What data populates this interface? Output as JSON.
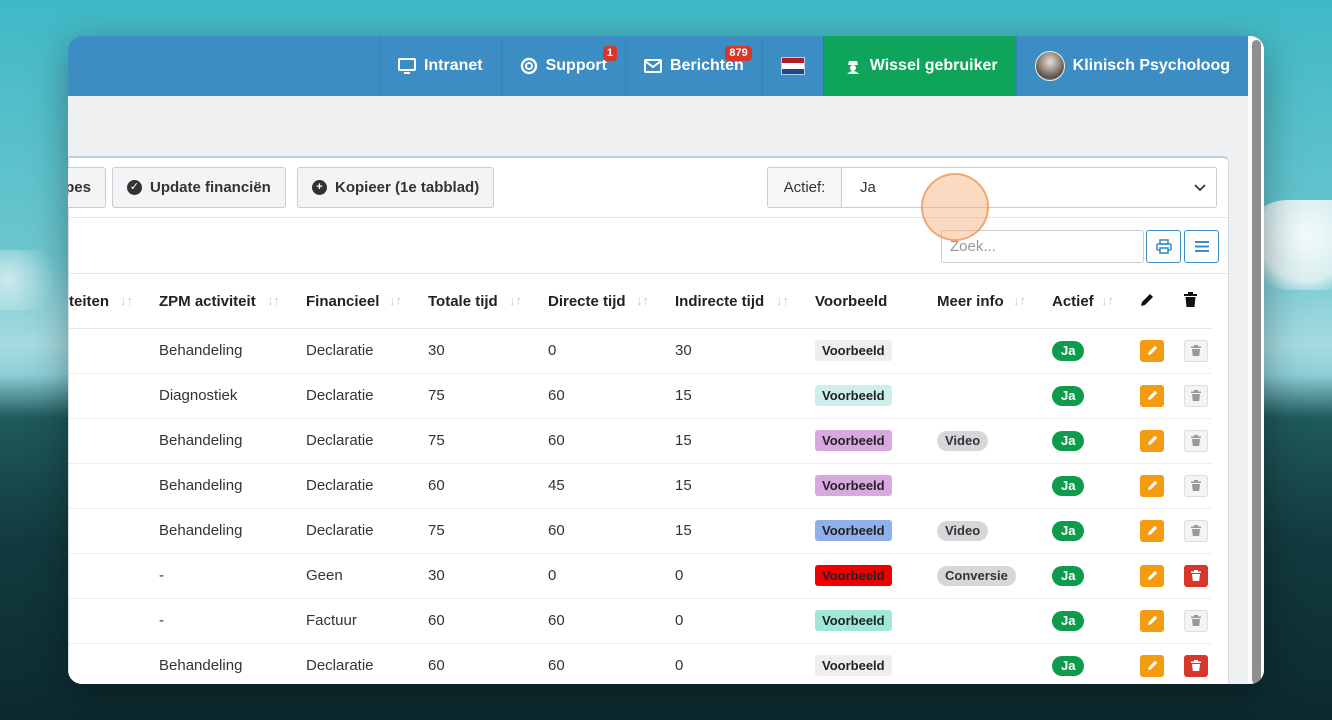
{
  "topbar": {
    "intranet": "Intranet",
    "support": "Support",
    "support_badge": "1",
    "berichten": "Berichten",
    "berichten_badge": "879",
    "wissel": "Wissel gebruiker",
    "user": "Klinisch Psycholoog"
  },
  "toolbar": {
    "partial_btn": "pes",
    "update_btn": "Update financiën",
    "kopieer_btn": "Kopieer (1e tabblad)",
    "filter_label": "Actief:",
    "filter_value": "Ja"
  },
  "search": {
    "placeholder": "Zoek..."
  },
  "table": {
    "headers": [
      "teiten",
      "ZPM activiteit",
      "Financieel",
      "Totale tijd",
      "Directe tijd",
      "Indirecte tijd",
      "Voorbeeld",
      "Meer info",
      "Actief"
    ],
    "rows": [
      {
        "zpm": "Behandeling",
        "fin": "Declaratie",
        "tot": "30",
        "dir": "0",
        "ind": "30",
        "vb": "Voorbeeld",
        "vb_bg": "#eeeeee",
        "vb_fg": "#222222",
        "info": "",
        "actief": "Ja",
        "del": false
      },
      {
        "zpm": "Diagnostiek",
        "fin": "Declaratie",
        "tot": "75",
        "dir": "60",
        "ind": "15",
        "vb": "Voorbeeld",
        "vb_bg": "#cdeeea",
        "vb_fg": "#222222",
        "info": "",
        "actief": "Ja",
        "del": false
      },
      {
        "zpm": "Behandeling",
        "fin": "Declaratie",
        "tot": "75",
        "dir": "60",
        "ind": "15",
        "vb": "Voorbeeld",
        "vb_bg": "#d9a8e0",
        "vb_fg": "#222222",
        "info": "Video",
        "actief": "Ja",
        "del": false
      },
      {
        "zpm": "Behandeling",
        "fin": "Declaratie",
        "tot": "60",
        "dir": "45",
        "ind": "15",
        "vb": "Voorbeeld",
        "vb_bg": "#d9a8e0",
        "vb_fg": "#222222",
        "info": "",
        "actief": "Ja",
        "del": false
      },
      {
        "zpm": "Behandeling",
        "fin": "Declaratie",
        "tot": "75",
        "dir": "60",
        "ind": "15",
        "vb": "Voorbeeld",
        "vb_bg": "#8fb0ea",
        "vb_fg": "#222222",
        "info": "Video",
        "actief": "Ja",
        "del": false
      },
      {
        "zpm": "-",
        "fin": "Geen",
        "tot": "30",
        "dir": "0",
        "ind": "0",
        "vb": "Voorbeeld",
        "vb_bg": "#ee0000",
        "vb_fg": "#222222",
        "info": "Conversie",
        "actief": "Ja",
        "del": true
      },
      {
        "zpm": "-",
        "fin": "Factuur",
        "tot": "60",
        "dir": "60",
        "ind": "0",
        "vb": "Voorbeeld",
        "vb_bg": "#9fe8d8",
        "vb_fg": "#222222",
        "info": "",
        "actief": "Ja",
        "del": false
      },
      {
        "zpm": "Behandeling",
        "fin": "Declaratie",
        "tot": "60",
        "dir": "60",
        "ind": "0",
        "vb": "Voorbeeld",
        "vb_bg": "#eeeeee",
        "vb_fg": "#222222",
        "info": "",
        "actief": "Ja",
        "del": true
      }
    ]
  },
  "colors": {
    "topbar": "#3c8dc4",
    "green": "#0ea55a",
    "edit": "#f39c12",
    "danger": "#d9362b"
  }
}
